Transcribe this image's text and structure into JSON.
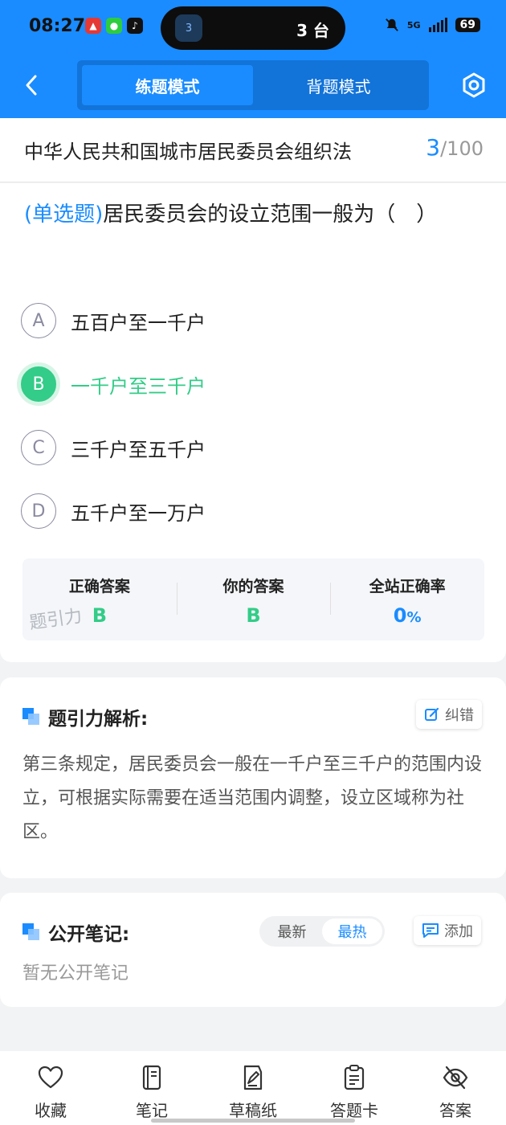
{
  "status_bar": {
    "time": "08:27",
    "island_badge": "3",
    "island_text": "3 台",
    "network": "5G",
    "battery": "69"
  },
  "nav": {
    "tabs": [
      {
        "label": "练题模式",
        "active": true
      },
      {
        "label": "背题模式",
        "active": false
      }
    ]
  },
  "exam": {
    "title": "中华人民共和国城市居民委员会组织法",
    "current": "3",
    "total": "/100"
  },
  "question": {
    "type": "(单选题)",
    "text": "居民委员会的设立范围一般为（　）",
    "options": [
      {
        "letter": "A",
        "text": "五百户至一千户",
        "selected": false
      },
      {
        "letter": "B",
        "text": "一千户至三千户",
        "selected": true
      },
      {
        "letter": "C",
        "text": "三千户至五千户",
        "selected": false
      },
      {
        "letter": "D",
        "text": "五千户至一万户",
        "selected": false
      }
    ]
  },
  "answer_summary": {
    "correct_label": "正确答案",
    "correct_value": "B",
    "yours_label": "你的答案",
    "yours_value": "B",
    "rate_label": "全站正确率",
    "rate_value": "0",
    "rate_unit": "%",
    "watermark": "题引力"
  },
  "analysis": {
    "title": "题引力解析:",
    "report_label": "纠错",
    "text": "第三条规定，居民委员会一般在一千户至三千户的范围内设立，可根据实际需要在适当范围内调整，设立区域称为社区。"
  },
  "notes": {
    "title": "公开笔记:",
    "sort_latest": "最新",
    "sort_hot": "最热",
    "add_label": "添加",
    "empty_text": "暂无公开笔记"
  },
  "bottom_bar": {
    "items": [
      {
        "label": "收藏",
        "icon": "heart-icon"
      },
      {
        "label": "笔记",
        "icon": "notebook-icon"
      },
      {
        "label": "草稿纸",
        "icon": "draft-icon"
      },
      {
        "label": "答题卡",
        "icon": "answer-sheet-icon"
      },
      {
        "label": "答案",
        "icon": "eye-off-icon"
      }
    ]
  },
  "colors": {
    "brand": "#1a8cff",
    "correct": "#33cc88"
  }
}
